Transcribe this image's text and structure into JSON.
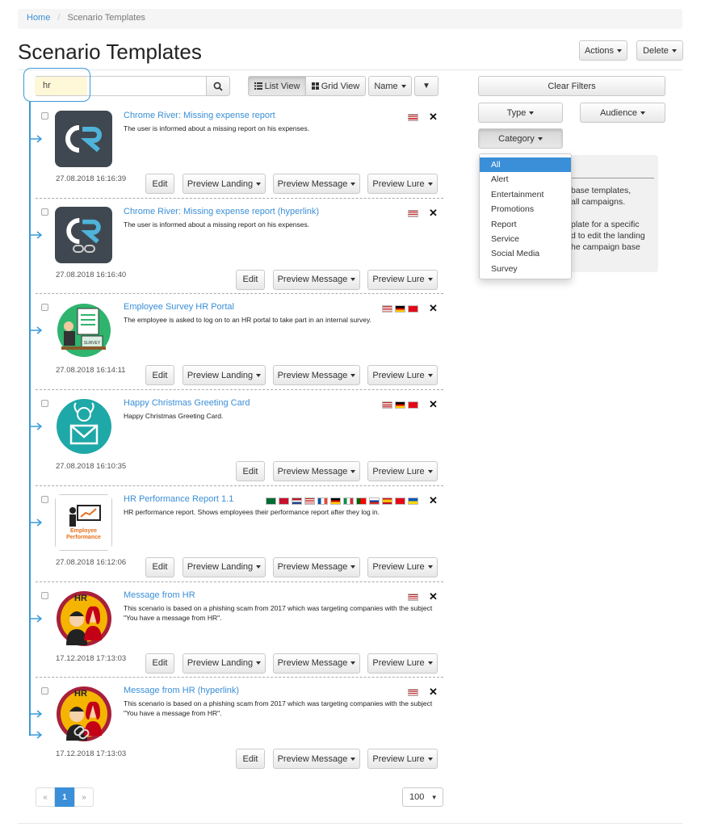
{
  "breadcrumb": {
    "home": "Home",
    "separator": "/",
    "current": "Scenario Templates"
  },
  "page_title": "Scenario Templates",
  "header_actions": {
    "actions": "Actions",
    "delete": "Delete"
  },
  "search": {
    "value": "hr",
    "icon": "search-icon"
  },
  "toolbar": {
    "list_view": "List View",
    "grid_view": "Grid View",
    "sort": "Name",
    "filter_icon": "▼"
  },
  "filters": {
    "clear": "Clear Filters",
    "type": "Type",
    "audience": "Audience",
    "category": "Category",
    "category_options": [
      "All",
      "Alert",
      "Entertainment",
      "Promotions",
      "Report",
      "Service",
      "Social Media",
      "Survey"
    ],
    "category_selected": "All"
  },
  "info_panel": {
    "lines": [
      "base templates,",
      "all campaigns.",
      "",
      "plate for a specific",
      "d to edit the landing",
      "he campaign base"
    ]
  },
  "button_labels": {
    "edit": "Edit",
    "preview_landing": "Preview Landing",
    "preview_message": "Preview Message",
    "preview_lure": "Preview Lure"
  },
  "templates": [
    {
      "title": "Chrome River: Missing expense report",
      "description": "The user is informed about a missing report on his expenses.",
      "date": "27.08.2018 16:16:39",
      "icon": "chrome-river-logo",
      "flags": [
        "us"
      ],
      "has_landing": true
    },
    {
      "title": "Chrome River: Missing expense report (hyperlink)",
      "description": "The user is informed about a missing report on his expenses.",
      "date": "27.08.2018 16:16:40",
      "icon": "chrome-river-link-logo",
      "flags": [
        "us"
      ],
      "has_landing": false
    },
    {
      "title": "Employee Survey HR Portal",
      "description": "The employee is asked to log on to an HR portal to take part in an internal survey.",
      "date": "27.08.2018 16:14:11",
      "icon": "survey-illustration",
      "flags": [
        "us",
        "de",
        "tr"
      ],
      "has_landing": true
    },
    {
      "title": "Happy Christmas Greeting Card",
      "description": "Happy Christmas Greeting Card.",
      "date": "27.08.2018 16:10:35",
      "icon": "christmas-card-illustration",
      "flags": [
        "us",
        "de",
        "tr"
      ],
      "has_landing": false
    },
    {
      "title": "HR Performance Report 1.1",
      "description": "HR performance report. Shows employees their performance report after they log in.",
      "date": "27.08.2018 16:12:06",
      "icon": "performance-board-illustration",
      "thumb_text_1": "Employee",
      "thumb_text_2": "Performance",
      "flags": [
        "sa",
        "dk",
        "nl",
        "us",
        "fr",
        "de",
        "it",
        "pt",
        "ru",
        "es",
        "tr",
        "ua"
      ],
      "has_landing": true
    },
    {
      "title": "Message from HR",
      "description": "This scenario is based on a phishing scam from 2017 which was targeting companies with the subject \"You have a message from HR\".",
      "date": "17.12.2018 17:13:03",
      "icon": "hr-people-illustration",
      "thumb_text_1": "HR",
      "flags": [
        "us"
      ],
      "has_landing": true
    },
    {
      "title": "Message from HR (hyperlink)",
      "description": "This scenario is based on a phishing scam from 2017 which was targeting companies with the subject \"You have a message from HR\".",
      "date": "17.12.2018 17:13:03",
      "icon": "hr-people-link-illustration",
      "thumb_text_1": "HR",
      "flags": [
        "us"
      ],
      "has_landing": false
    }
  ],
  "pagination": {
    "prev": "«",
    "current": "1",
    "next": "»"
  },
  "page_size": {
    "value": "100",
    "caret": "▾"
  },
  "colors": {
    "accent": "#3a8fd8",
    "callout": "#3a9ad9",
    "search_highlight": "#fef7d8"
  }
}
